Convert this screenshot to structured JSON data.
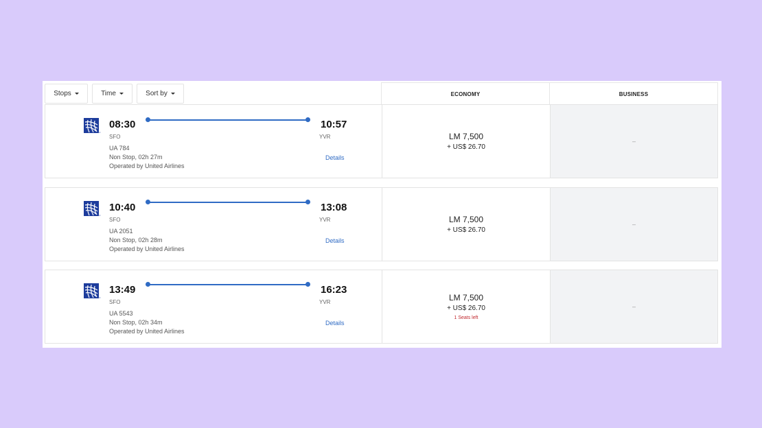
{
  "filters": [
    {
      "label": "Stops"
    },
    {
      "label": "Time"
    },
    {
      "label": "Sort by"
    }
  ],
  "columns": {
    "economy": "ECONOMY",
    "business": "BUSINESS"
  },
  "colors": {
    "accent": "#2f6bc4",
    "warning": "#c0272d",
    "background": "#d9cbfb",
    "disabled_cell": "#f2f3f5"
  },
  "flights": [
    {
      "airline_icon": "united-airlines-globe-icon",
      "depart_time": "08:30",
      "depart_airport": "SFO",
      "arrive_time": "10:57",
      "arrive_airport": "YVR",
      "flight_number": "UA 784",
      "stops_duration": "Non Stop, 02h 27m",
      "operated_by": "Operated by United Airlines",
      "details_label": "Details",
      "economy": {
        "miles": "LM 7,500",
        "tax": "+ US$ 26.70",
        "seats_left": ""
      },
      "business": "–"
    },
    {
      "airline_icon": "united-airlines-globe-icon",
      "depart_time": "10:40",
      "depart_airport": "SFO",
      "arrive_time": "13:08",
      "arrive_airport": "YVR",
      "flight_number": "UA 2051",
      "stops_duration": "Non Stop, 02h 28m",
      "operated_by": "Operated by United Airlines",
      "details_label": "Details",
      "economy": {
        "miles": "LM 7,500",
        "tax": "+ US$ 26.70",
        "seats_left": ""
      },
      "business": "–"
    },
    {
      "airline_icon": "united-airlines-globe-icon",
      "depart_time": "13:49",
      "depart_airport": "SFO",
      "arrive_time": "16:23",
      "arrive_airport": "YVR",
      "flight_number": "UA 5543",
      "stops_duration": "Non Stop, 02h 34m",
      "operated_by": "Operated by United Airlines",
      "details_label": "Details",
      "economy": {
        "miles": "LM 7,500",
        "tax": "+ US$ 26.70",
        "seats_left": "1 Seats left"
      },
      "business": "–"
    }
  ]
}
